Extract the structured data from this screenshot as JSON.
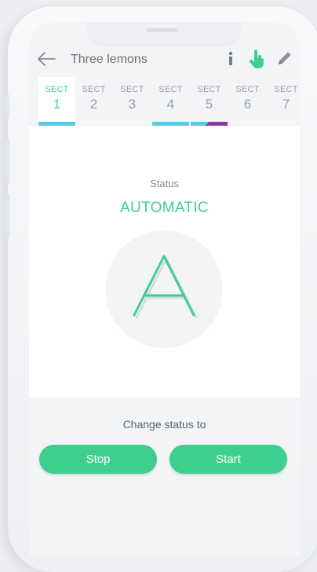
{
  "header": {
    "title": "Three lemons",
    "icons": [
      "back-arrow-icon",
      "info-icon",
      "hand-pointer-icon",
      "pencil-icon"
    ]
  },
  "tabs": [
    {
      "label": "SECT",
      "number": "1",
      "active": true,
      "bar": [
        "#56cbe8"
      ]
    },
    {
      "label": "SECT",
      "number": "2",
      "active": false,
      "bar": []
    },
    {
      "label": "SECT",
      "number": "3",
      "active": false,
      "bar": []
    },
    {
      "label": "SECT",
      "number": "4",
      "active": false,
      "bar": [
        "#56cbe8"
      ]
    },
    {
      "label": "SECT",
      "number": "5",
      "active": false,
      "bar": [
        "#56cbe8",
        "#8e3aa0"
      ]
    },
    {
      "label": "SECT",
      "number": "6",
      "active": false,
      "bar": []
    },
    {
      "label": "SECT",
      "number": "7",
      "active": false,
      "bar": []
    }
  ],
  "status": {
    "label": "Status",
    "value": "AUTOMATIC",
    "icon": "automatic-a-icon"
  },
  "change": {
    "label": "Change status to",
    "stop": "Stop",
    "start": "Start"
  },
  "colors": {
    "accent": "#3ecf8e",
    "tab_blue": "#56cbe8",
    "tab_purple": "#8e3aa0"
  }
}
